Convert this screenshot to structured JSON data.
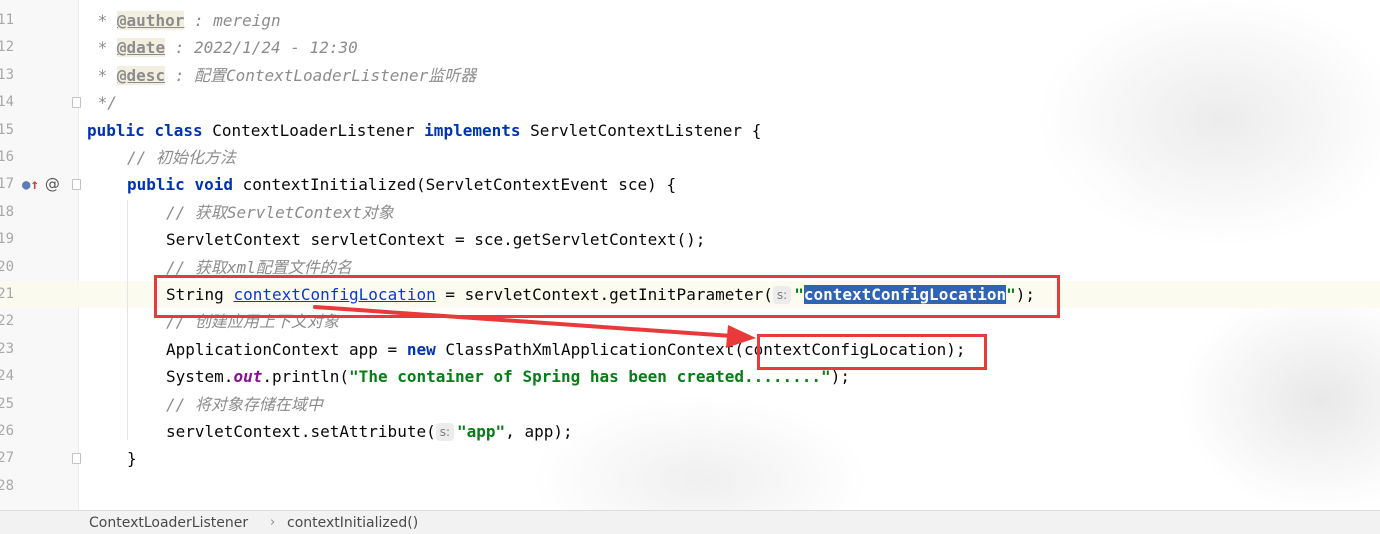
{
  "editor": {
    "lines": [
      {
        "num": "11"
      },
      {
        "num": "12"
      },
      {
        "num": "13"
      },
      {
        "num": "14"
      },
      {
        "num": "15"
      },
      {
        "num": "16"
      },
      {
        "num": "17"
      },
      {
        "num": "18"
      },
      {
        "num": "19"
      },
      {
        "num": "20"
      },
      {
        "num": "21"
      },
      {
        "num": "22"
      },
      {
        "num": "23"
      },
      {
        "num": "24"
      },
      {
        "num": "25"
      },
      {
        "num": "26"
      },
      {
        "num": "27"
      },
      {
        "num": "28"
      }
    ],
    "doc": {
      "prefix": " * ",
      "author_tag": "@author",
      "author_value": " : mereign",
      "date_tag": "@date",
      "date_value": " : 2022/1/24 - 12:30",
      "desc_tag": "@desc",
      "desc_value": " : 配置ContextLoaderListener监听器",
      "close": " */"
    },
    "class_decl": {
      "kw1": "public",
      "kw2": "class",
      "name": " ContextLoaderListener ",
      "kw3": "implements",
      "iface": " ServletContextListener {"
    },
    "comment_init": "// 初始化方法",
    "method_decl": {
      "kw1": "public",
      "kw2": "void",
      "rest": " contextInitialized(ServletContextEvent sce) {"
    },
    "comment_get_ctx": "// 获取ServletContext对象",
    "line_get_ctx": "ServletContext servletContext = sce.getServletContext();",
    "comment_get_xml": "// 获取xml配置文件的名",
    "line_param": {
      "type": "String ",
      "var": "contextConfigLocation",
      "mid": " = servletContext.getInitParameter(",
      "hint": "s:",
      "quote_open": "\"",
      "selected": "contextConfigLocation",
      "quote_close": "\"",
      "end": ");"
    },
    "comment_create": "// 创建应用上下文对象",
    "line_app": {
      "start": "ApplicationContext app = ",
      "kw": "new",
      "rest": " ClassPathXmlApplicationContext",
      "boxed": "(contextConfigLocation)",
      "end": ";"
    },
    "line_print": {
      "start": "System.",
      "field": "out",
      "mid": ".println(",
      "str": "\"The container of Spring has been created........\"",
      "end": ");"
    },
    "comment_store": "// 将对象存储在域中",
    "line_set": {
      "start": "servletContext.setAttribute(",
      "hint": "s:",
      "str": "\"app\"",
      "end": ", app);"
    },
    "close_brace": "}",
    "override_marker": "@"
  },
  "breadcrumb": {
    "items": [
      "ContextLoaderListener",
      "contextInitialized()"
    ],
    "separator": "›"
  },
  "colors": {
    "keyword": "#0033b3",
    "comment": "#8c8c8c",
    "string": "#067d17",
    "selection": "#2f63b4",
    "annotation_box": "#e8393b"
  }
}
